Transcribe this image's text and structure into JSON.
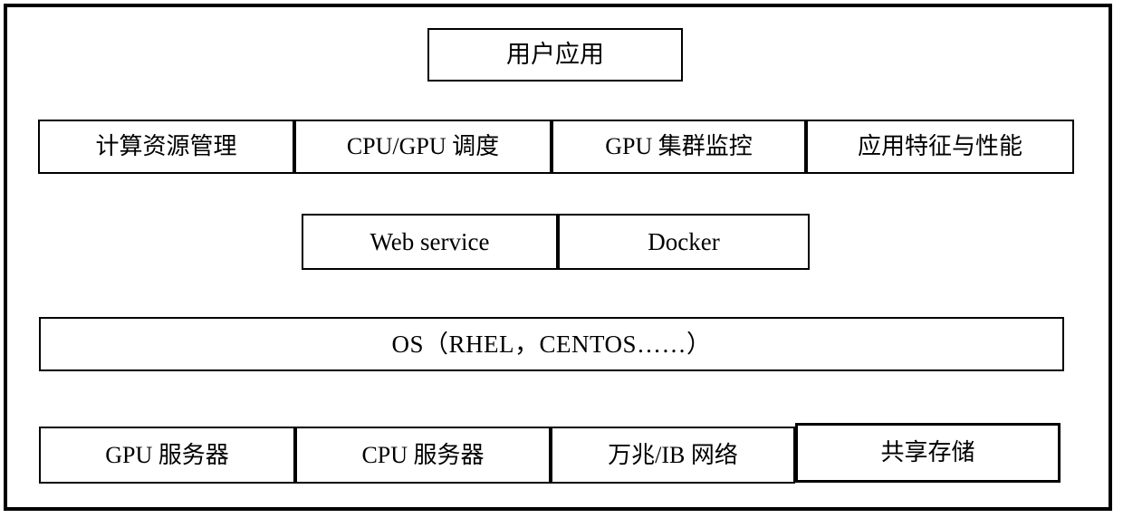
{
  "diagram": {
    "title": "GPU cluster software stack architecture",
    "colors": {
      "frame": "#000000",
      "box_border": "#000000",
      "background": "#ffffff",
      "text": "#000000"
    },
    "layers": [
      {
        "id": "application",
        "cells": [
          {
            "label": "用户应用"
          }
        ]
      },
      {
        "id": "platform",
        "cells": [
          {
            "label": "计算资源管理"
          },
          {
            "label": "CPU/GPU 调度"
          },
          {
            "label": "GPU 集群监控"
          },
          {
            "label": "应用特征与性能"
          }
        ]
      },
      {
        "id": "services",
        "cells": [
          {
            "label": "Web service"
          },
          {
            "label": "Docker"
          }
        ]
      },
      {
        "id": "os",
        "cells": [
          {
            "label": "OS（RHEL，CENTOS……）"
          }
        ]
      },
      {
        "id": "hardware",
        "cells": [
          {
            "label": "GPU 服务器"
          },
          {
            "label": "CPU 服务器"
          },
          {
            "label": "万兆/IB 网络"
          },
          {
            "label": "共享存储"
          }
        ]
      }
    ]
  }
}
